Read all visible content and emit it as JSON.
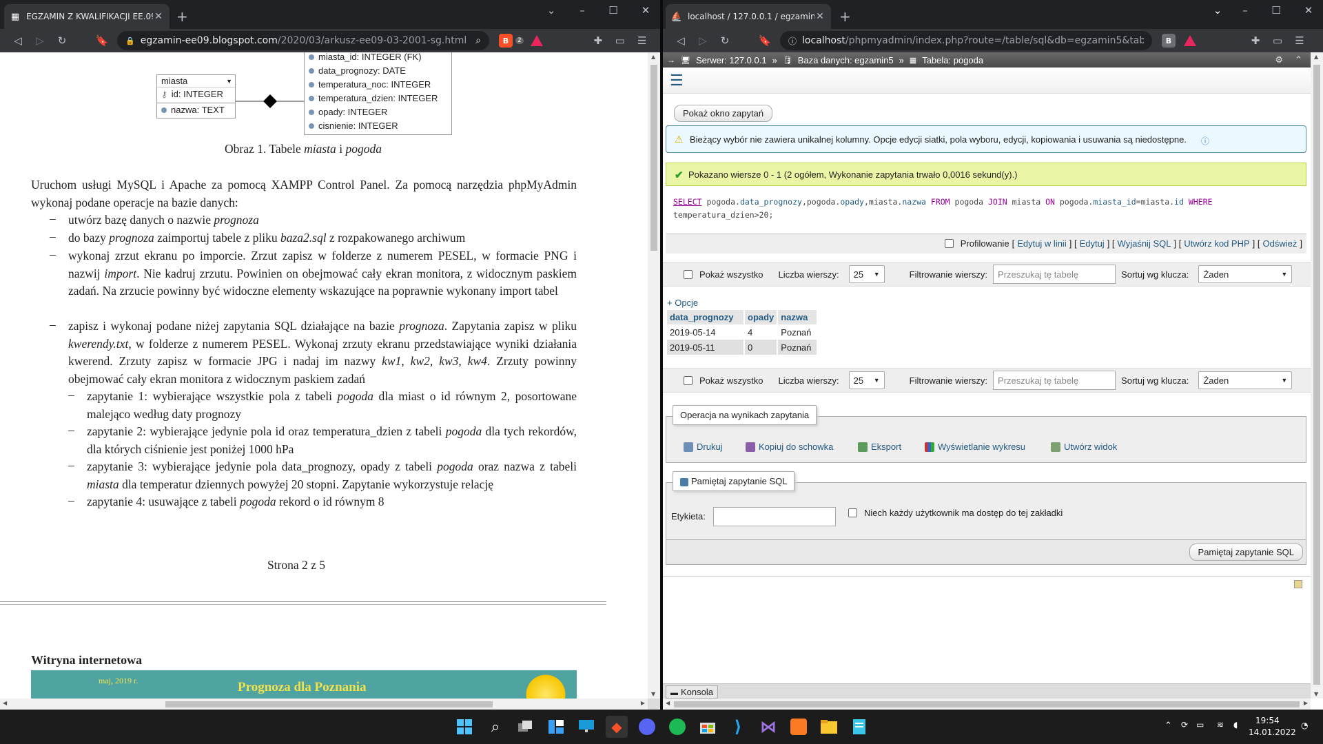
{
  "left_browser": {
    "tab_title": "EGZAMIN Z KWALIFIKACJI EE.09...",
    "url_main": "egzamin-ee09.blogspot.com",
    "url_rest": "/2020/03/arkusz-ee09-03-2001-sg.html",
    "brave_badge": "2"
  },
  "doc": {
    "table_miasta": {
      "name": "miasta",
      "fields": [
        "id: INTEGER",
        "nazwa: TEXT"
      ]
    },
    "table_pogoda": {
      "fields": [
        "miasta_id: INTEGER (FK)",
        "data_prognozy: DATE",
        "temperatura_noc: INTEGER",
        "temperatura_dzien: INTEGER",
        "opady: INTEGER",
        "cisnienie: INTEGER"
      ]
    },
    "caption_pre": "Obraz 1. Tabele ",
    "caption_i1": "miasta",
    "caption_mid": " i ",
    "caption_i2": "pogoda",
    "intro": "Uruchom usługi MySQL i Apache za pomocą XAMPP Control Panel. Za pomocą narzędzia phpMyAdmin wykonaj podane operacje na bazie danych:",
    "li1_a": "utwórz bazę danych o nazwie ",
    "li1_b": "prognoza",
    "li2_a": "do bazy ",
    "li2_b": "prognoza",
    "li2_c": " zaimportuj tabele z pliku ",
    "li2_d": "baza2.sql",
    "li2_e": " z rozpakowanego archiwum",
    "li3_a": "wykonaj zrzut ekranu po imporcie. Zrzut zapisz w folderze z numerem PESEL, w formacie PNG i nazwij ",
    "li3_b": "import",
    "li3_c": ". Nie kadruj zrzutu. Powinien on obejmować cały ekran monitora, z widocznym paskiem zadań. Na zrzucie powinny być widoczne elementy wskazujące na poprawnie wykonany import tabel",
    "li4_a": "zapisz i wykonaj podane niżej zapytania SQL działające na bazie ",
    "li4_b": "prognoza",
    "li4_c": ". Zapytania zapisz w pliku ",
    "li4_d": "kwerendy.txt",
    "li4_e": ", w folderze z numerem PESEL. Wykonaj zrzuty ekranu przedstawiające wyniki działania kwerend. Zrzuty zapisz w formacie JPG i nadaj im nazwy ",
    "li4_f": "kw1",
    "li4_g": ", ",
    "li4_h": "kw2",
    "li4_i": ", ",
    "li4_j": "kw3",
    "li4_k": ", ",
    "li4_l": "kw4",
    "li4_m": ". Zrzuty powinny obejmować cały ekran monitora z widocznym paskiem zadań",
    "q1_a": "zapytanie 1: wybierające wszystkie pola z tabeli ",
    "q1_b": "pogoda",
    "q1_c": " dla miast o id równym 2, posortowane malejąco według daty prognozy",
    "q2_a": "zapytanie 2: wybierające jedynie pola id oraz temperatura_dzien z tabeli ",
    "q2_b": "pogoda",
    "q2_c": " dla tych rekordów, dla których ciśnienie jest poniżej 1000 hPa",
    "q3_a": "zapytanie 3: wybierające jedynie pola data_prognozy, opady z tabeli ",
    "q3_b": "pogoda",
    "q3_c": " oraz nazwa z tabeli ",
    "q3_d": "miasta",
    "q3_e": " dla temperatur dziennych powyżej 20 stopni. Zapytanie wykorzystuje relację",
    "q4_a": "zapytanie 4: usuwające z tabeli ",
    "q4_b": "pogoda",
    "q4_c": " rekord o id równym 8",
    "page_num": "Strona 2 z 5",
    "section_title": "Witryna internetowa",
    "banner_date": "maj, 2019 r.",
    "banner_title": "Prognoza dla Poznania"
  },
  "right_browser": {
    "tab_title": "localhost / 127.0.0.1 / egzamin5 / ...",
    "url_main": "localhost",
    "url_rest": "/phpmyadmin/index.php?route=/table/sql&db=egzamin5&table=po..."
  },
  "pma": {
    "bc_server": "Serwer: 127.0.0.1",
    "bc_db": "Baza danych: egzamin5",
    "bc_table": "Tabela: pogoda",
    "show_query_btn": "Pokaż okno zapytań",
    "notice": "Bieżący wybór nie zawiera unikalnej kolumny. Opcje edycji siatki, pola wyboru, edycji, kopiowania i usuwania są niedostępne.",
    "success": "Pokazano wiersze 0 - 1 (2 ogółem, Wykonanie zapytania trwało 0,0016 sekund(y).)",
    "sql": {
      "t1": "SELECT",
      "t2": " pogoda.",
      "t3": "data_prognozy",
      "t4": ",pogoda.",
      "t5": "opady",
      "t6": ",miasta.",
      "t7": "nazwa",
      "t8": " FROM ",
      "t9": "pogoda ",
      "t10": "JOIN",
      "t11": " miasta ",
      "t12": "ON",
      "t13": " pogoda.",
      "t14": "miasta_id",
      "t15": "=miasta.",
      "t16": "id",
      "t17": " WHERE",
      "line2": "temperatura_dzien>20;"
    },
    "profiling": "Profilowanie",
    "links": [
      "Edytuj w linii",
      "Edytuj",
      "Wyjaśnij SQL",
      "Utwórz kod PHP",
      "Odśwież"
    ],
    "show_all": "Pokaż wszystko",
    "rows_label": "Liczba wierszy:",
    "rows_value": "25",
    "filter_label": "Filtrowanie wierszy:",
    "filter_placeholder": "Przeszukaj tę tabelę",
    "sort_label": "Sortuj wg klucza:",
    "sort_value": "Żaden",
    "options": "+ Opcje",
    "columns": [
      "data_prognozy",
      "opady",
      "nazwa"
    ],
    "rows": [
      [
        "2019-05-14",
        "4",
        "Poznań"
      ],
      [
        "2019-05-11",
        "0",
        "Poznań"
      ]
    ],
    "ops_legend": "Operacja na wynikach zapytania",
    "ops": [
      "Drukuj",
      "Kopiuj do schowka",
      "Eksport",
      "Wyświetlanie wykresu",
      "Utwórz widok"
    ],
    "bookmark_legend": "Pamiętaj zapytanie SQL",
    "label_label": "Etykieta:",
    "share_label": "Niech każdy użytkownik ma dostęp do tej zakładki",
    "bookmark_btn": "Pamiętaj zapytanie SQL",
    "console": "Konsola"
  },
  "taskbar": {
    "time": "19:54",
    "date": "14.01.2022"
  }
}
